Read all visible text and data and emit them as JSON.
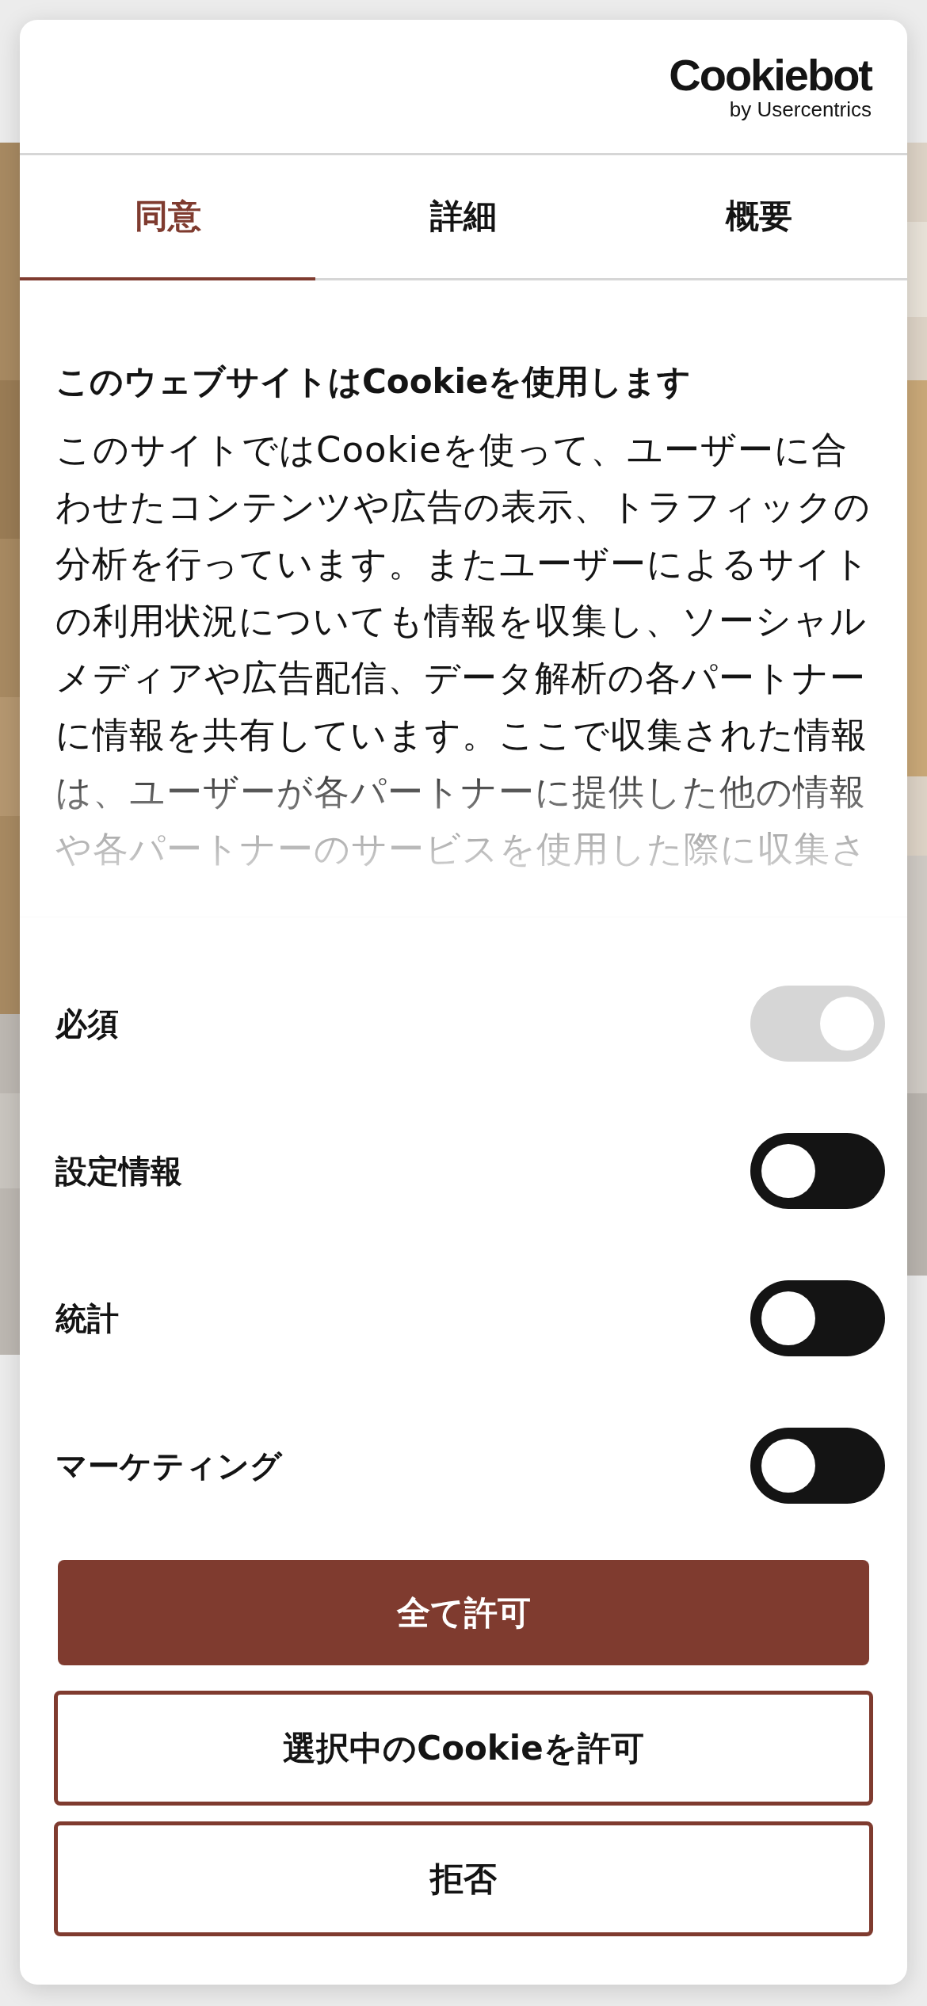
{
  "logo": {
    "name": "Cookiebot",
    "byline": "by Usercentrics"
  },
  "tabs": [
    {
      "label": "同意",
      "selected": true
    },
    {
      "label": "詳細",
      "selected": false
    },
    {
      "label": "概要",
      "selected": false
    }
  ],
  "consent": {
    "title": "このウェブサイトはCookieを使用します",
    "body": "このサイトではCookieを使って、ユーザーに合わせたコンテンツや広告の表示、トラフィックの分析を行っています。またユーザーによるサイトの利用状況についても情報を収集し、ソーシャルメディアや広告配信、データ解析の各パートナーに情報を共有しています。ここで収集された情報は、ユーザーが各パートナーに提供した他の情報や各パートナーのサービスを使用した際に収集さ"
  },
  "categories": [
    {
      "label": "必須",
      "on": true,
      "disabled": true
    },
    {
      "label": "設定情報",
      "on": false,
      "disabled": false
    },
    {
      "label": "統計",
      "on": false,
      "disabled": false
    },
    {
      "label": "マーケティング",
      "on": false,
      "disabled": false
    }
  ],
  "buttons": [
    {
      "label": "全て許可",
      "kind": "primary"
    },
    {
      "label": "選択中のCookieを許可",
      "kind": "outline"
    },
    {
      "label": "拒否",
      "kind": "outline"
    }
  ]
}
